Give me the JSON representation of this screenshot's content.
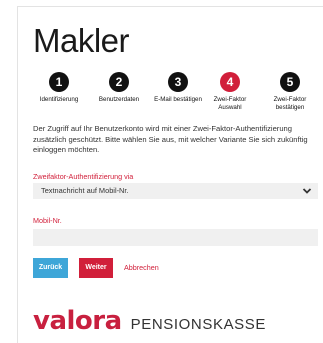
{
  "page": {
    "title": "Makler"
  },
  "steps": [
    {
      "number": "1",
      "label": "Identifizierung",
      "active": false
    },
    {
      "number": "2",
      "label": "Benutzerdaten",
      "active": false
    },
    {
      "number": "3",
      "label": "E-Mail bestätigen",
      "active": false
    },
    {
      "number": "4",
      "label": "Zwei-Faktor Auswahl",
      "active": true
    },
    {
      "number": "5",
      "label": "Zwei-Faktor bestätigen",
      "active": false
    }
  ],
  "intro": "Der Zugriff auf Ihr Benutzerkonto wird mit einer Zwei-Faktor-Authentifizierung zusätzlich geschützt. Bitte wählen Sie aus, mit welcher Variante Sie sich zukünftig einloggen möchten.",
  "twofactor": {
    "label": "Zweifaktor-Authentifizierung via",
    "selected": "Textnachricht auf Mobil-Nr."
  },
  "mobile": {
    "label": "Mobil-Nr.",
    "value": ""
  },
  "buttons": {
    "back": "Zurück",
    "next": "Weiter",
    "cancel": "Abbrechen"
  },
  "logo": {
    "brand": "valora",
    "sub": "PENSIONSKASSE"
  },
  "colors": {
    "accent": "#d11f3a",
    "secondary": "#3ea6d8",
    "field_bg": "#f0f0f0"
  }
}
